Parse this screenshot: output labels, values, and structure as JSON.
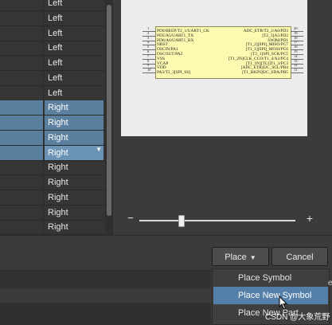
{
  "pin_table": {
    "rows": [
      {
        "side": "Left",
        "selected": false
      },
      {
        "side": "Left",
        "selected": false
      },
      {
        "side": "Left",
        "selected": false
      },
      {
        "side": "Left",
        "selected": false
      },
      {
        "side": "Left",
        "selected": false
      },
      {
        "side": "Left",
        "selected": false
      },
      {
        "side": "Left",
        "selected": false
      },
      {
        "side": "Right",
        "selected": true
      },
      {
        "side": "Right",
        "selected": true
      },
      {
        "side": "Right",
        "selected": true
      },
      {
        "side": "Right",
        "selected": true,
        "active": true
      },
      {
        "side": "Right",
        "selected": false
      },
      {
        "side": "Right",
        "selected": false
      },
      {
        "side": "Right",
        "selected": false
      },
      {
        "side": "Right",
        "selected": false
      },
      {
        "side": "Right",
        "selected": false
      }
    ],
    "dropdown_arrow": "▼"
  },
  "symbol": {
    "left_pins": [
      {
        "num": "1",
        "name": "PD0/BEEP/T2_1/UART1_CK"
      },
      {
        "num": "2",
        "name": "PD5/A5/UART1_TX"
      },
      {
        "num": "3",
        "name": "PD6/A6/UART1_RX"
      },
      {
        "num": "4",
        "name": "NRST"
      },
      {
        "num": "5",
        "name": "OSCIN/PA1"
      },
      {
        "num": "6",
        "name": "OSCOUT/PA2"
      },
      {
        "num": "7",
        "name": "VSS"
      },
      {
        "num": "8",
        "name": "VCAP"
      },
      {
        "num": "9",
        "name": "VDD"
      },
      {
        "num": "10",
        "name": "PA3/T2_3[SPI_SS]"
      }
    ],
    "right_pins": [
      {
        "num": "20",
        "name": "ADC_ETR/T2_2/A6/PD3"
      },
      {
        "num": "19",
        "name": "[T2_3]A5/PD2"
      },
      {
        "num": "18",
        "name": "SWIM/PD1"
      },
      {
        "num": "17",
        "name": "[T1_2][SPI]_MISO/PC7"
      },
      {
        "num": "16",
        "name": "[T1_1][SPI]_MOSI/PC6"
      },
      {
        "num": "15",
        "name": "[T2_1]SPI_SCK/PC5"
      },
      {
        "num": "14",
        "name": "[T1_2N]CLK_CCO/T1_4/A2/PC4"
      },
      {
        "num": "13",
        "name": "[T1_1N][TLI]T1_3/PC3"
      },
      {
        "num": "12",
        "name": "[ADC_ETR]I2C_SCL/PB4"
      },
      {
        "num": "11",
        "name": "[T1_BKIN]I2C_SDA/PB5"
      }
    ]
  },
  "zoom": {
    "minus": "−",
    "plus": "+",
    "level": 0.27
  },
  "buttons": {
    "place": "Place",
    "place_arrow": "▼",
    "cancel": "Cancel"
  },
  "place_menu": {
    "items": [
      "Place Symbol",
      "Place New Symbol",
      "Place New Part"
    ],
    "highlighted_index": 1
  },
  "watermark": "CSDN @大象荒野",
  "edge_glyph": "e",
  "colors": {
    "selection": "#5b7f9e",
    "menu_highlight": "#537fa8",
    "symbol_fill": "#fcf9b0",
    "background": "#3b3b3b"
  }
}
